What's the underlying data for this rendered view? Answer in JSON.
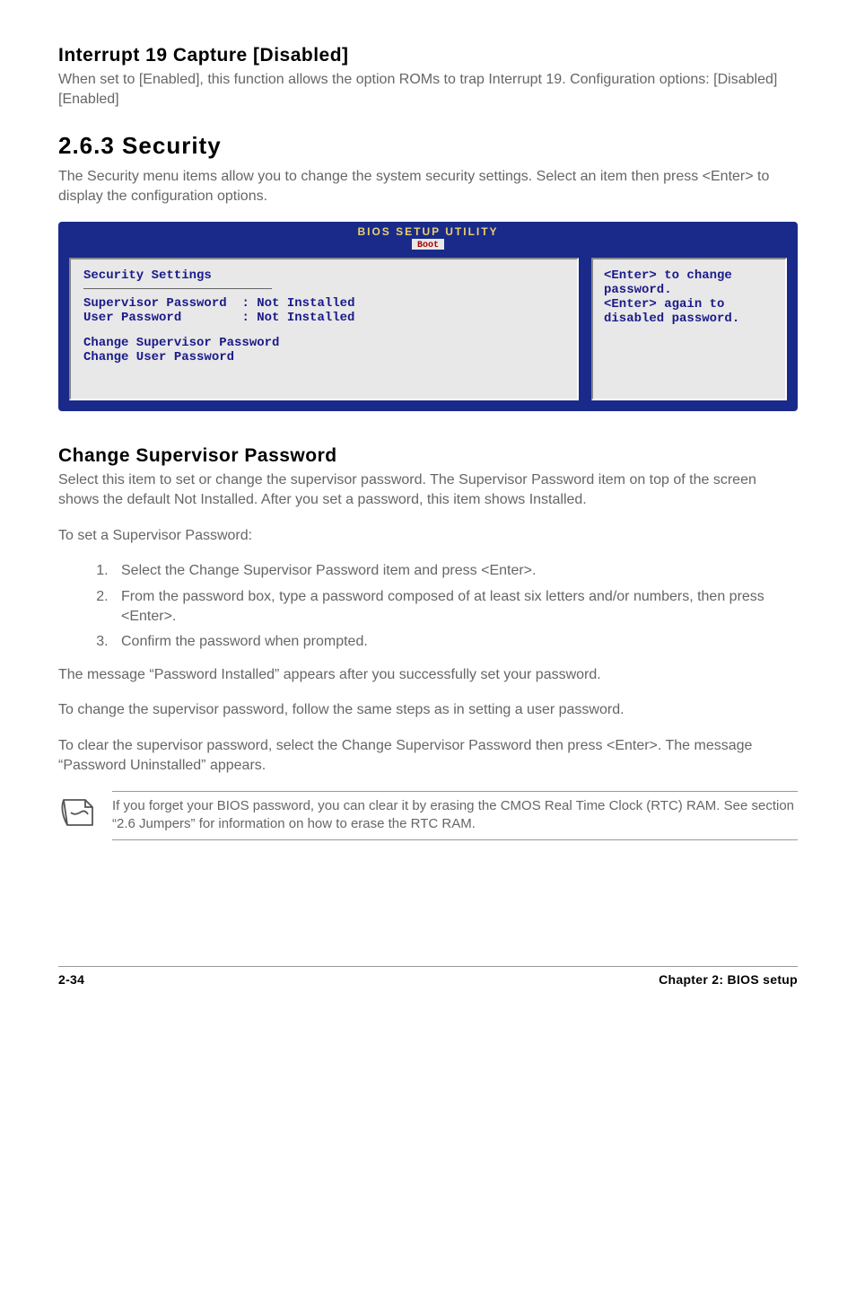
{
  "interrupt": {
    "title": "Interrupt 19 Capture [Disabled]",
    "desc": "When set to [Enabled], this function allows the option ROMs to trap Interrupt 19. Configuration options: [Disabled] [Enabled]"
  },
  "security_section": {
    "title": "2.6.3   Security",
    "desc": "The Security menu items allow you to change the system security settings. Select an item then press <Enter> to display the configuration options."
  },
  "bios": {
    "header_top": "BIOS SETUP UTILITY",
    "header_tab": "Boot",
    "left": {
      "title": "Security Settings",
      "row1_label": "Supervisor Password",
      "row1_value": ": Not Installed",
      "row2_label": "User Password",
      "row2_value": ": Not Installed",
      "row3": "Change Supervisor Password",
      "row4": "Change User Password"
    },
    "right": {
      "line1": "<Enter> to change",
      "line2": "password.",
      "line3": "<Enter> again to",
      "line4": "disabled password."
    }
  },
  "change_pw": {
    "title": "Change Supervisor Password",
    "p1": "Select this item to set or change the supervisor password. The Supervisor Password item on top of the screen shows the default Not Installed. After you set a password, this item shows Installed.",
    "p2": "To set a Supervisor Password:",
    "steps": [
      "Select the Change Supervisor Password item and press <Enter>.",
      "From the password box, type a password composed of at least six letters and/or numbers, then press <Enter>.",
      "Confirm the password when prompted."
    ],
    "p3": "The message “Password Installed” appears after you successfully set your password.",
    "p4": "To change the supervisor password, follow the same steps as in setting a user password.",
    "p5": "To clear the supervisor password, select the Change Supervisor Password then press <Enter>. The message “Password Uninstalled” appears."
  },
  "note": {
    "text": "If you forget your BIOS password, you can clear it by erasing the CMOS Real Time Clock (RTC) RAM. See section “2.6  Jumpers” for information on how to erase the RTC RAM."
  },
  "footer": {
    "left": "2-34",
    "right": "Chapter 2: BIOS setup"
  }
}
